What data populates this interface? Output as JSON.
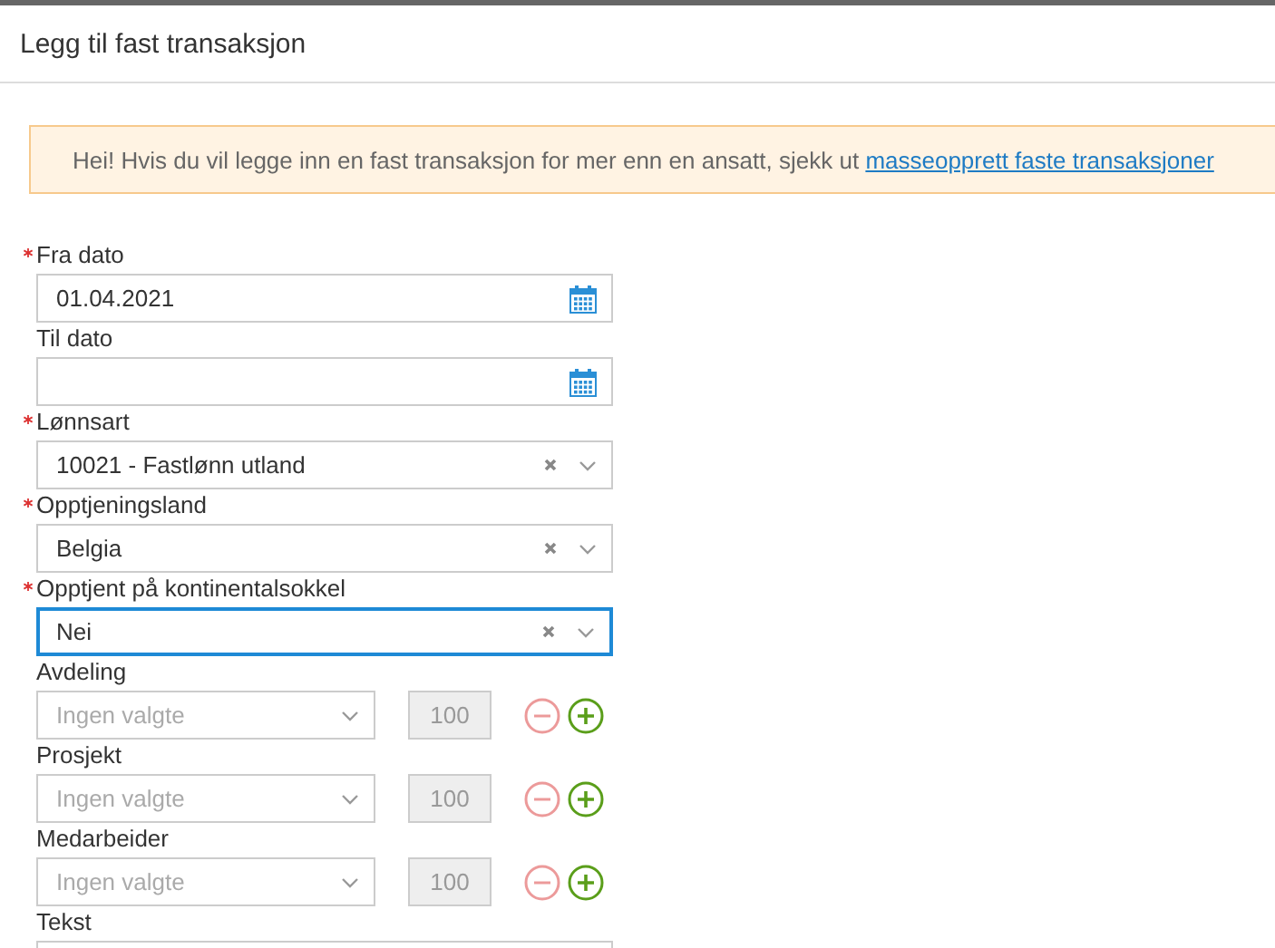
{
  "dialog": {
    "title": "Legg til fast transaksjon"
  },
  "notice": {
    "text": "Hei! Hvis du vil legge inn en fast transaksjon for mer enn en ansatt, sjekk ut",
    "link": "masseopprett faste transaksjoner"
  },
  "fields": [
    {
      "kind": "date",
      "label": "Fra dato",
      "required": true,
      "value": "01.04.2021",
      "focused": false
    },
    {
      "kind": "date",
      "label": "Til dato",
      "required": false,
      "focused": false
    },
    {
      "kind": "select",
      "label": "Lønnsart",
      "required": true,
      "value": "10021 - Fastlønn utland",
      "focused": false
    },
    {
      "kind": "select",
      "label": "Opptjeningsland",
      "required": true,
      "value": "Belgia",
      "focused": false
    },
    {
      "kind": "select",
      "label": "Opptjent på kontinentalsokkel",
      "required": true,
      "value": "Nei",
      "focused": true
    },
    {
      "kind": "split",
      "label": "Avdeling",
      "required": false,
      "placeholder": "Ingen valgte",
      "share": "100",
      "focused": false
    },
    {
      "kind": "split",
      "label": "Prosjekt",
      "required": false,
      "placeholder": "Ingen valgte",
      "share": "100",
      "focused": false
    },
    {
      "kind": "split",
      "label": "Medarbeider",
      "required": false,
      "placeholder": "Ingen valgte",
      "share": "100",
      "focused": false
    },
    {
      "kind": "text",
      "label": "Tekst",
      "required": false,
      "focused": false
    }
  ]
}
